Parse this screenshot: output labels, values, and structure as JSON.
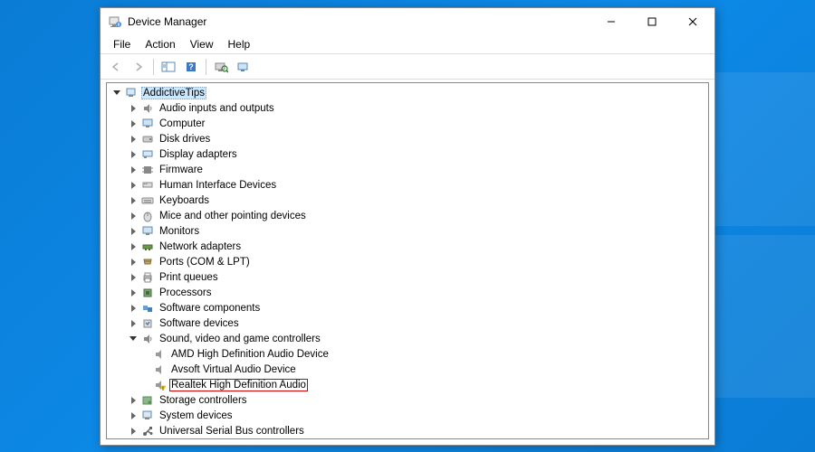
{
  "window": {
    "title": "Device Manager"
  },
  "menu": {
    "file": "File",
    "action": "Action",
    "view": "View",
    "help": "Help"
  },
  "tree": {
    "root": "AddictiveTips",
    "audio_io": "Audio inputs and outputs",
    "computer": "Computer",
    "disk": "Disk drives",
    "display": "Display adapters",
    "firmware": "Firmware",
    "hid": "Human Interface Devices",
    "keyboards": "Keyboards",
    "mice": "Mice and other pointing devices",
    "monitors": "Monitors",
    "network": "Network adapters",
    "ports": "Ports (COM & LPT)",
    "print": "Print queues",
    "processors": "Processors",
    "softcomp": "Software components",
    "softdev": "Software devices",
    "sound": "Sound, video and game controllers",
    "sound_amd": "AMD High Definition Audio Device",
    "sound_avsoft": "Avsoft Virtual Audio Device",
    "sound_realtek": "Realtek High Definition Audio",
    "storage": "Storage controllers",
    "system": "System devices",
    "usb": "Universal Serial Bus controllers"
  }
}
